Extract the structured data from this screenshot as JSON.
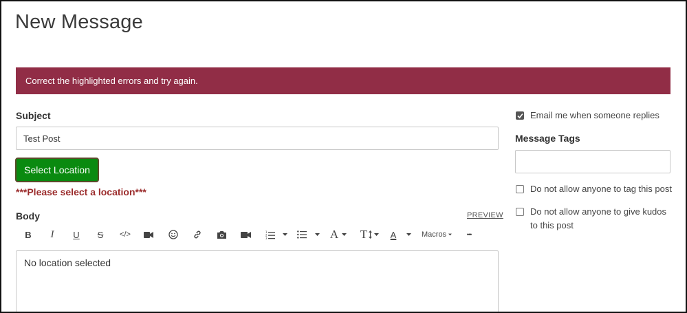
{
  "page": {
    "title": "New Message"
  },
  "error_banner": {
    "text": "Correct the highlighted errors and try again."
  },
  "subject": {
    "label": "Subject",
    "value": "Test Post"
  },
  "location": {
    "button_label": "Select Location",
    "error_text": "***Please select a location***"
  },
  "body": {
    "label": "Body",
    "preview_label": "PREVIEW",
    "content": "No location selected"
  },
  "toolbar": {
    "bold": "B",
    "italic": "I",
    "underline": "U",
    "strikethrough": "S",
    "code": "</>",
    "font_family": "A",
    "font_size": "T",
    "font_color": "A",
    "macros_label": "Macros",
    "more": "•••",
    "icons": [
      "bold-icon",
      "italic-icon",
      "underline-icon",
      "strikethrough-icon",
      "code-icon",
      "video-icon",
      "emoji-icon",
      "link-icon",
      "camera-icon",
      "video-camera-icon",
      "numbered-list-icon",
      "bulleted-list-icon",
      "font-family-icon",
      "font-size-icon",
      "font-color-icon",
      "macros-menu",
      "more-icon"
    ]
  },
  "sidebar": {
    "email_notify": {
      "label": "Email me when someone replies",
      "checked": true
    },
    "tags": {
      "label": "Message Tags",
      "value": ""
    },
    "no_tag": {
      "label": "Do not allow anyone to tag this post",
      "checked": false
    },
    "no_kudos": {
      "label": "Do not allow anyone to give kudos to this post",
      "checked": false
    }
  },
  "colors": {
    "error_banner_bg": "#912d46",
    "select_location_bg": "#0a8a10",
    "error_text": "#9b2c2c"
  }
}
